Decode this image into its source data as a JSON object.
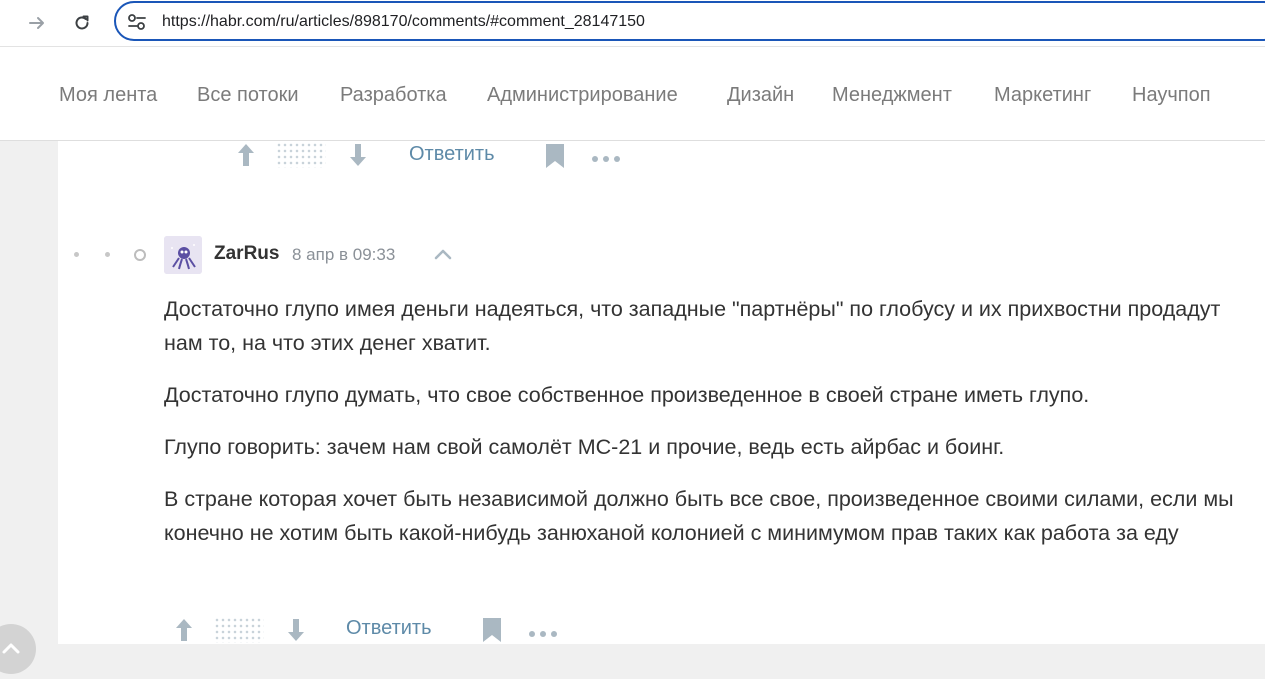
{
  "browser": {
    "url": "https://habr.com/ru/articles/898170/comments/#comment_28147150"
  },
  "nav": {
    "items": [
      "Моя лента",
      "Все потоки",
      "Разработка",
      "Администрирование",
      "Дизайн",
      "Менеджмент",
      "Маркетинг",
      "Научпоп"
    ]
  },
  "prev_comment": {
    "reply_label": "Ответить"
  },
  "comment": {
    "author": "ZarRus",
    "time": "8 апр в 09:33",
    "paragraphs": [
      "Достаточно глупо имея деньги надеяться, что западные \"партнёры\" по глобусу и их прихвостни продадут нам то, на что этих денег хватит.",
      "Достаточно глупо думать, что свое собственное произведенное в своей стране иметь глупо.",
      "Глупо говорить: зачем нам свой самолёт МС-21 и прочие, ведь есть айрбас и боинг.",
      "В стране которая хочет быть независимой должно быть все свое, произведенное своими силами, если мы конечно не хотим быть какой-нибудь занюханой колонией с минимумом прав таких как работа за еду"
    ],
    "reply_label": "Ответить"
  },
  "colors": {
    "url_border": "#1a56b8",
    "nav_text": "#7b7b7b",
    "reply_link": "#5e8aa8",
    "vote_icon": "#aab8c2"
  }
}
